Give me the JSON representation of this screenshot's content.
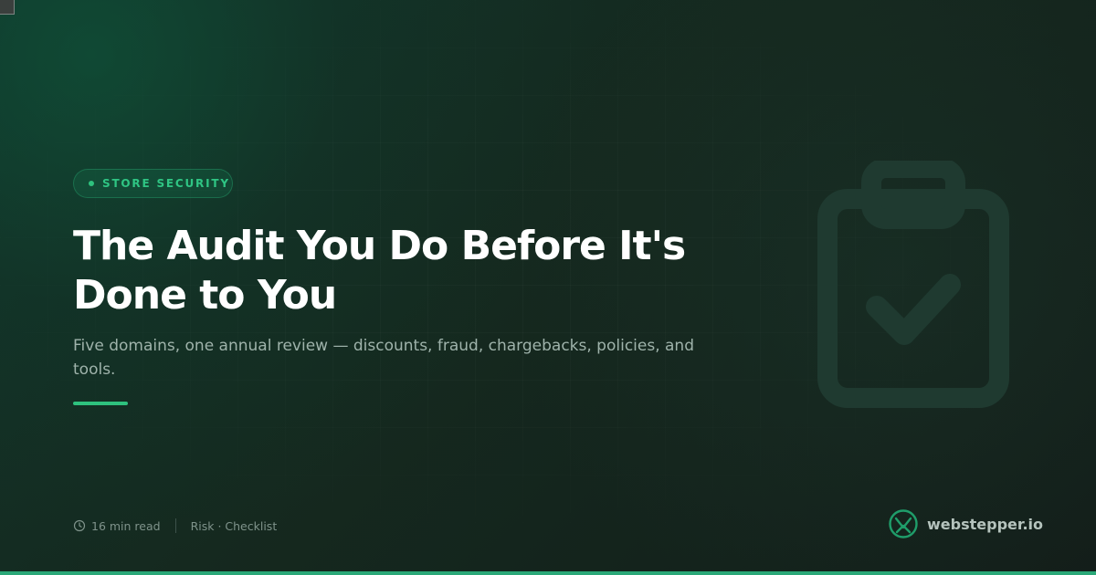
{
  "category": {
    "label": "STORE SECURITY"
  },
  "article": {
    "title": "The Audit You Do Before It's Done to You",
    "subtitle": "Five domains, one annual review — discounts, fraud, chargebacks, policies, and tools.",
    "read_time": "16 min read",
    "tags": "Risk · Checklist"
  },
  "brand": {
    "name": "webstepper.io",
    "logo_icon": "webstepper-logo-icon"
  },
  "icons": {
    "watermark": "clipboard-check-icon",
    "meta": "clock-icon"
  },
  "colors": {
    "accent": "#2ec27e",
    "background": "#132620",
    "title": "#ffffff",
    "subtitle": "#9fb3ab"
  }
}
